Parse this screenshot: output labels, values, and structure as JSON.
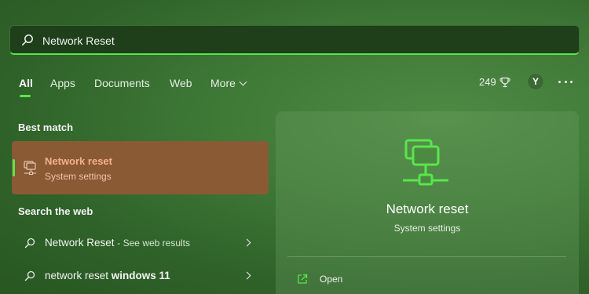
{
  "search": {
    "query": "Network Reset"
  },
  "tabs": [
    {
      "label": "All",
      "active": true
    },
    {
      "label": "Apps"
    },
    {
      "label": "Documents"
    },
    {
      "label": "Web"
    },
    {
      "label": "More"
    }
  ],
  "header": {
    "points": "249",
    "avatar_initial": "Y"
  },
  "best_match": {
    "heading": "Best match",
    "title": "Network reset",
    "subtitle": "System settings",
    "icon": "pc-icon"
  },
  "web": {
    "heading": "Search the web",
    "results": [
      {
        "text": "Network Reset",
        "suffix": "- See web results"
      },
      {
        "prefix": "network reset ",
        "bold": "windows 11"
      }
    ]
  },
  "preview": {
    "title": "Network reset",
    "subtitle": "System settings",
    "open_label": "Open",
    "icon": "network-icon"
  },
  "colors": {
    "accent": "#58e64a",
    "highlight": "#8a5a35",
    "background": "#3f7a37"
  }
}
